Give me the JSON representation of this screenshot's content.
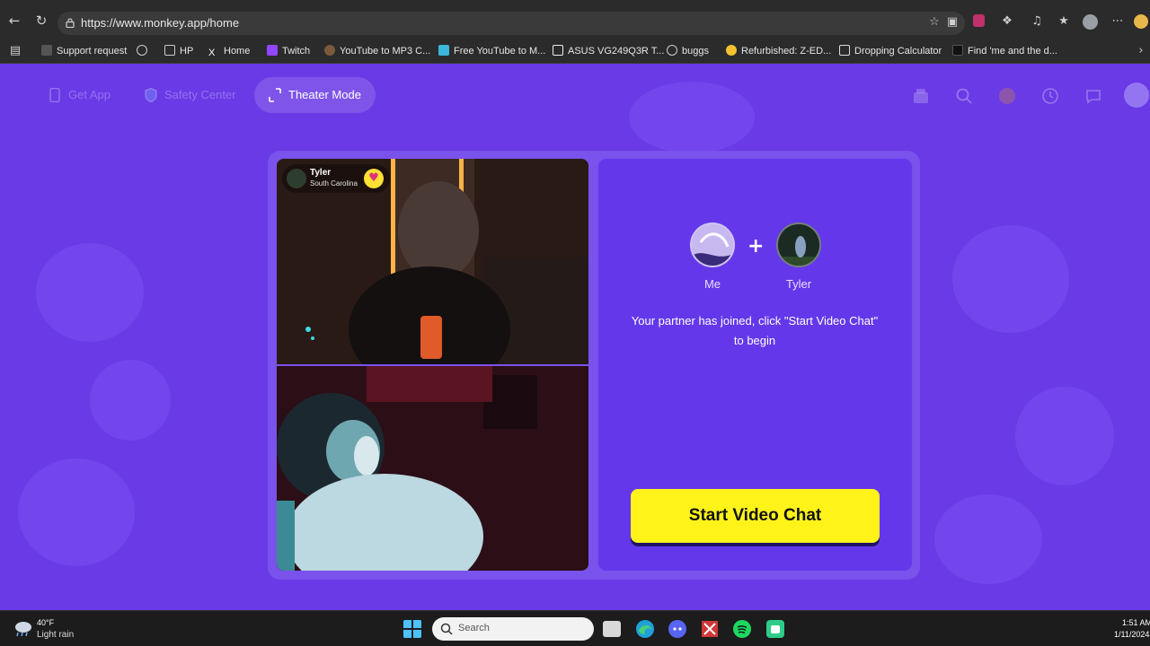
{
  "browser": {
    "url": "https://www.monkey.app/home",
    "bookmarks": [
      {
        "label": "Support request",
        "icon": "page-icon"
      },
      {
        "label": "",
        "icon": "globe-icon"
      },
      {
        "label": "HP",
        "icon": "folder-icon"
      },
      {
        "label": "Home",
        "icon": "x-logo-icon"
      },
      {
        "label": "Twitch",
        "icon": "twitch-icon"
      },
      {
        "label": "YouTube to MP3 C...",
        "icon": "monkey-favicon-icon"
      },
      {
        "label": "Free YouTube to M...",
        "icon": "y2mate-icon"
      },
      {
        "label": "ASUS VG249Q3R T...",
        "icon": "rtings-icon"
      },
      {
        "label": "buggs",
        "icon": "globe-icon"
      },
      {
        "label": "Refurbished: Z-ED...",
        "icon": "newegg-icon"
      },
      {
        "label": "Dropping Calculator",
        "icon": "calculator-icon"
      },
      {
        "label": "Find 'me and the d...",
        "icon": "tiktok-icon"
      }
    ]
  },
  "topnav": {
    "get_app": "Get App",
    "safety_center": "Safety Center",
    "theater_mode": "Theater Mode"
  },
  "video": {
    "partner_name": "Tyler",
    "partner_location": "South Carolina"
  },
  "panel": {
    "me_label": "Me",
    "partner_label": "Tyler",
    "plus": "+",
    "message": "Your partner has joined, click \"Start Video Chat\" to begin",
    "start_button": "Start Video Chat"
  },
  "taskbar": {
    "weather_temp": "40°F",
    "weather_desc": "Light rain",
    "search_placeholder": "Search",
    "clock_time": "1:51 AM",
    "clock_date": "1/11/2024"
  },
  "colors": {
    "page_bg": "#6a3ae6",
    "accent_button": "#fff31a",
    "heart_badge": "#ffe033"
  }
}
